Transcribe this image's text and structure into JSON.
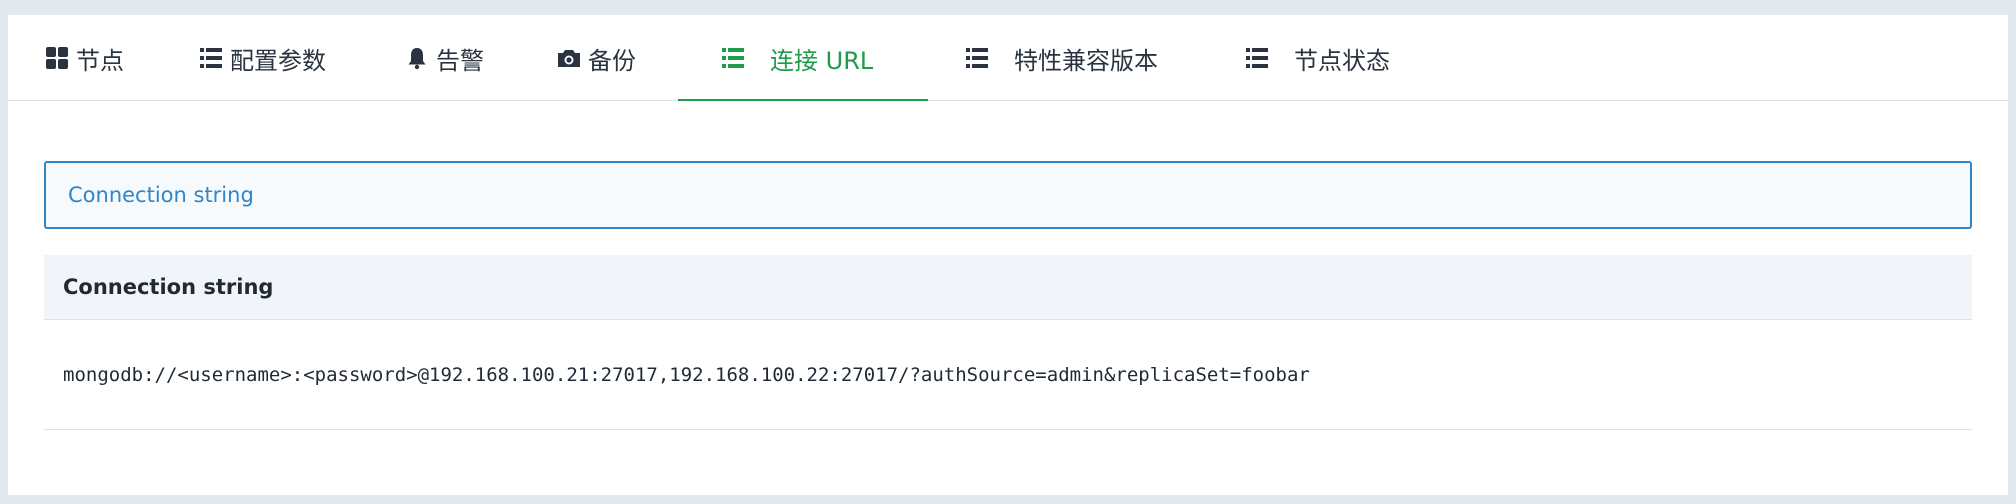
{
  "tabs": [
    {
      "label": "节点",
      "icon": "grid-icon"
    },
    {
      "label": "配置参数",
      "icon": "list-icon"
    },
    {
      "label": "告警",
      "icon": "bell-icon"
    },
    {
      "label": "备份",
      "icon": "camera-icon"
    },
    {
      "label": "连接 URL",
      "icon": "list-icon",
      "active": true
    },
    {
      "label": "特性兼容版本",
      "icon": "list-icon"
    },
    {
      "label": "节点状态",
      "icon": "list-icon"
    }
  ],
  "colors": {
    "active_tab": "#1e9c4a",
    "input_border": "#2f86c8",
    "text": "#2a3440"
  },
  "connection_input": {
    "value": "Connection string"
  },
  "table": {
    "header": "Connection string",
    "rows": [
      "mongodb://<username>:<password>@192.168.100.21:27017,192.168.100.22:27017/?authSource=admin&replicaSet=foobar"
    ]
  }
}
